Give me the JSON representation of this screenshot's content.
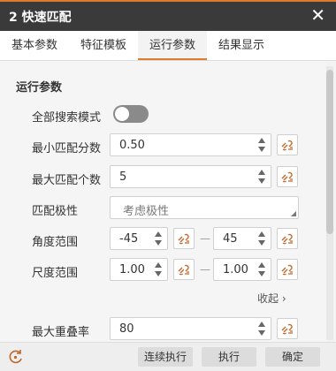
{
  "window": {
    "title": "2 快速匹配",
    "close_glyph": "✕"
  },
  "tabs": [
    "基本参数",
    "特征模板",
    "运行参数",
    "结果显示"
  ],
  "active_tab": "运行参数",
  "section": {
    "title": "运行参数"
  },
  "params": {
    "full_search": {
      "label": "全部搜索模式",
      "on": false
    },
    "min_score": {
      "label": "最小匹配分数",
      "value": "0.50"
    },
    "max_count": {
      "label": "最大匹配个数",
      "value": "5"
    },
    "polarity": {
      "label": "匹配极性",
      "placeholder": "考虑极性"
    },
    "angle_range": {
      "label": "角度范围",
      "min": "-45",
      "max": "45"
    },
    "scale_range": {
      "label": "尺度范围",
      "min": "1.00",
      "max": "1.00"
    },
    "max_overlap": {
      "label": "最大重叠率",
      "value": "80"
    }
  },
  "range_separator": "—",
  "collapse_label": "收起",
  "collapse_glyph": "›",
  "buttons": {
    "run_continuous": "连续执行",
    "run": "执行",
    "confirm": "确定"
  },
  "colors": {
    "accent": "#e07b2e",
    "titlebar": "#3a3a3a",
    "link_icon": "#c0662a"
  },
  "icons": {
    "close": "close-icon",
    "link": "link-icon",
    "refresh": "refresh-icon",
    "spin": "spin-arrows-icon"
  }
}
